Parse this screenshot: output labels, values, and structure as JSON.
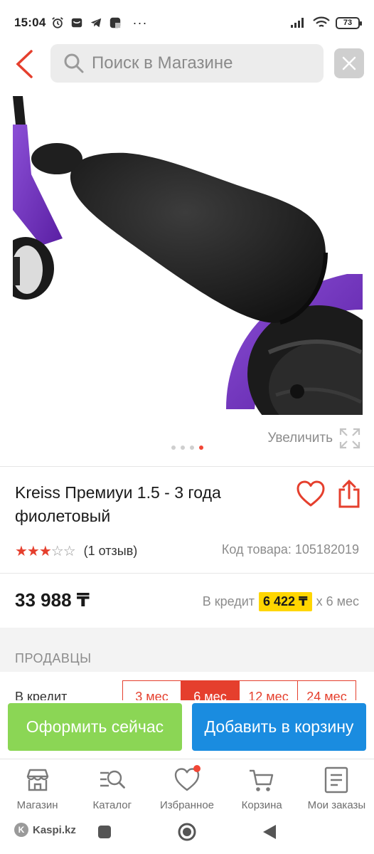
{
  "status_bar": {
    "time": "15:04",
    "battery": "73",
    "icons": [
      "alarm-icon",
      "mail-icon",
      "telegram-icon",
      "app-icon",
      "more-icon",
      "signal-icon",
      "wifi-icon",
      "battery-icon"
    ]
  },
  "header": {
    "search_placeholder": "Поиск в Магазине"
  },
  "gallery": {
    "zoom_label": "Увеличить",
    "dots_total": 4,
    "active_dot": 4
  },
  "product": {
    "title": "Kreiss Премиуи 1.5 - 3 года фиолетовый",
    "rating": 3,
    "rating_max": 5,
    "reviews": "(1 отзыв)",
    "code": "Код товара: 105182019",
    "price": "33 988 ₸",
    "credit_prefix": "В кредит",
    "credit_amount": "6 422 ₸",
    "credit_suffix": "x 6 мес"
  },
  "sellers": {
    "title": "ПРОДАВЦЫ",
    "credit_label": "В кредит",
    "terms": [
      "3 мес",
      "6 мес",
      "12 мес",
      "24 мес"
    ],
    "active_term": 1
  },
  "actions": {
    "checkout": "Оформить сейчас",
    "add_to_cart": "Добавить в корзину",
    "checkout_color": "#8bd655",
    "cart_color": "#1a8ce0"
  },
  "bottom_nav": {
    "items": [
      {
        "label": "Магазин",
        "icon": "store-icon"
      },
      {
        "label": "Каталог",
        "icon": "catalog-search-icon"
      },
      {
        "label": "Избранное",
        "icon": "heart-icon"
      },
      {
        "label": "Корзина",
        "icon": "cart-icon"
      },
      {
        "label": "Мои заказы",
        "icon": "orders-icon"
      }
    ]
  },
  "system_bar": {
    "brand": "Kaspi.kz"
  },
  "colors": {
    "accent": "#e53f2d",
    "credit_badge": "#ffd600",
    "product_purple": "#6a2bb0"
  }
}
